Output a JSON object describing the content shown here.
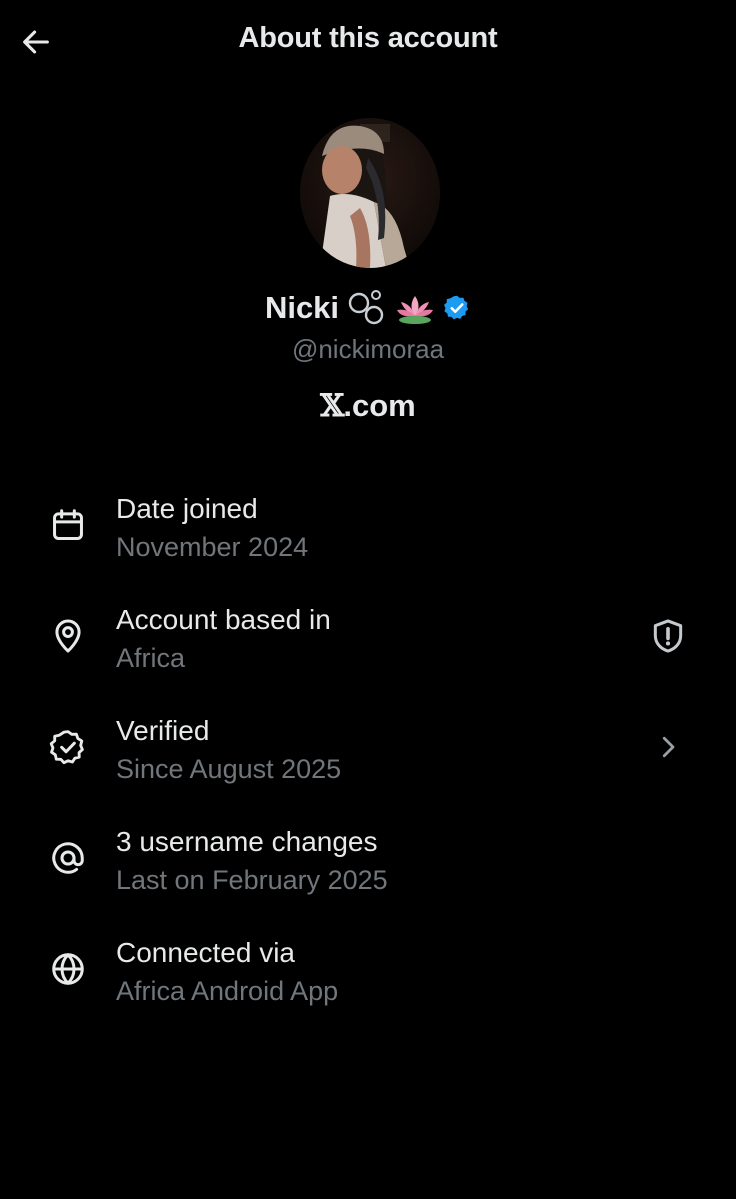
{
  "header": {
    "title": "About this account",
    "back_icon": "arrow-left-icon"
  },
  "profile": {
    "display_name": "Nicki",
    "name_emojis": [
      "bubbles-emoji",
      "lotus-emoji"
    ],
    "verified_badge_color": "#1d9bf0",
    "handle": "@nickimoraa",
    "site_mark": "𝕏",
    "site_suffix": ".com"
  },
  "rows": [
    {
      "icon": "calendar-icon",
      "title": "Date joined",
      "subtitle": "November 2024"
    },
    {
      "icon": "location-pin-icon",
      "title": "Account based in",
      "subtitle": "Africa",
      "trailing_icon": "shield-alert-icon"
    },
    {
      "icon": "verified-badge-icon",
      "title": "Verified",
      "subtitle": "Since August 2025",
      "trailing_icon": "chevron-right-icon"
    },
    {
      "icon": "at-sign-icon",
      "title": "3 username changes",
      "subtitle": "Last on February 2025"
    },
    {
      "icon": "globe-icon",
      "title": "Connected via",
      "subtitle": "Africa Android App"
    }
  ],
  "colors": {
    "background": "#000000",
    "primary_text": "#e7e9ea",
    "secondary_text": "#71767b",
    "accent": "#1d9bf0"
  }
}
